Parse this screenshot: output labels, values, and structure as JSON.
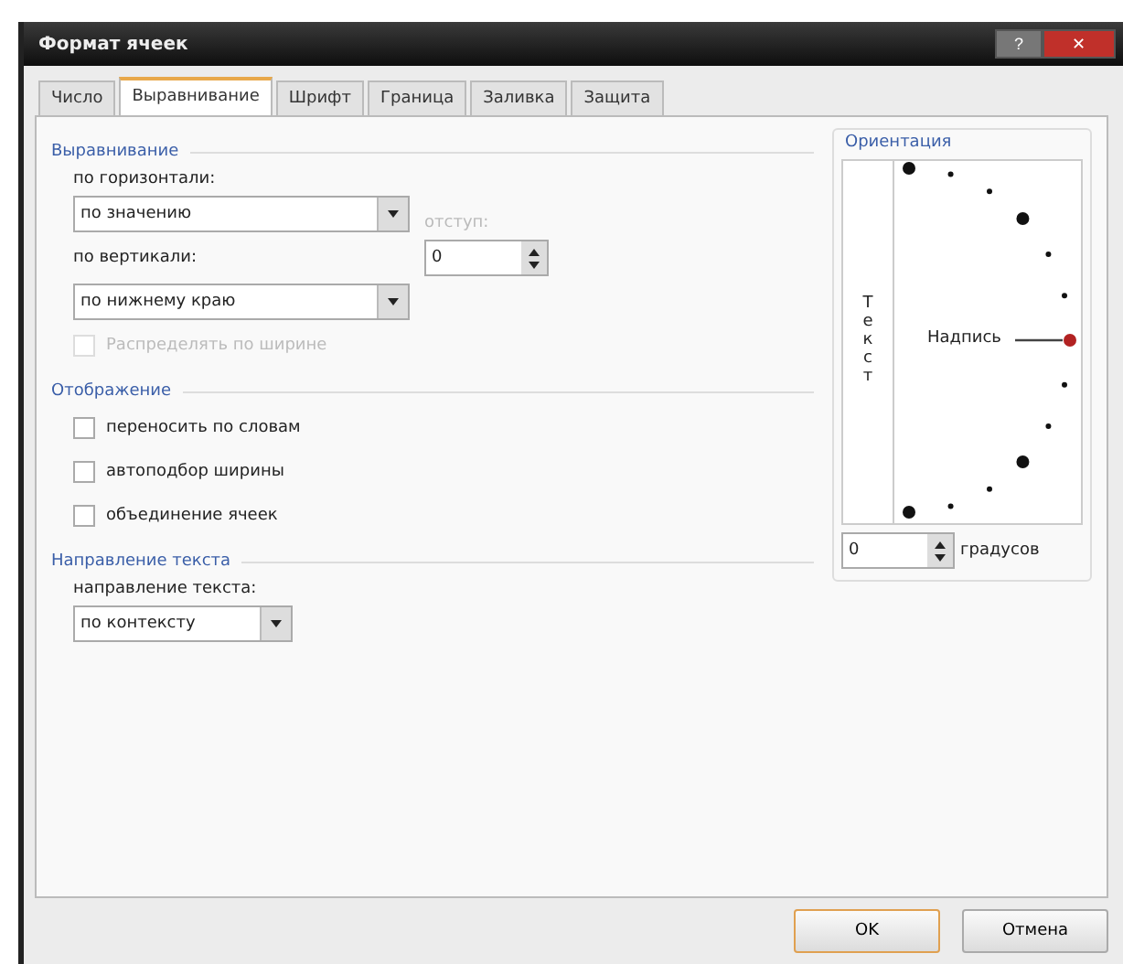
{
  "window": {
    "title": "Формат ячеек",
    "buttons": [
      {
        "kind": "help",
        "label": "?"
      },
      {
        "kind": "close",
        "label": "✕"
      }
    ]
  },
  "tabs": [
    {
      "label": "Число",
      "selected": false
    },
    {
      "label": "Выравнивание",
      "selected": true
    },
    {
      "label": "Шрифт",
      "selected": false
    },
    {
      "label": "Граница",
      "selected": false
    },
    {
      "label": "Заливка",
      "selected": false
    },
    {
      "label": "Защита",
      "selected": false
    }
  ],
  "alignment": {
    "title": "Выравнивание",
    "horizontal_label": "по горизонтали:",
    "horizontal_value": "по значению",
    "indent_label": "отступ:",
    "indent_disabled": true,
    "indent_value": "0",
    "vertical_label": "по вертикали:",
    "vertical_value": "по нижнему краю",
    "distribute": {
      "label": "Распределять по ширине",
      "checked": false,
      "disabled": true
    }
  },
  "display": {
    "title": "Отображение",
    "options": [
      {
        "label": "переносить по словам",
        "checked": false,
        "disabled": false
      },
      {
        "label": "автоподбор ширины",
        "checked": false,
        "disabled": false
      },
      {
        "label": "объединение ячеек",
        "checked": false,
        "disabled": false
      }
    ]
  },
  "direction": {
    "title": "Направление текста",
    "label": "направление текста:",
    "value": "по контексту"
  },
  "orientation": {
    "title": "Ориентация",
    "vertical_text": "Текст",
    "dial_label": "Надпись",
    "degrees_value": "0",
    "degrees_label": "градусов"
  },
  "buttons": [
    {
      "label": "OK",
      "default": true
    },
    {
      "label": "Отмена",
      "default": false
    }
  ]
}
